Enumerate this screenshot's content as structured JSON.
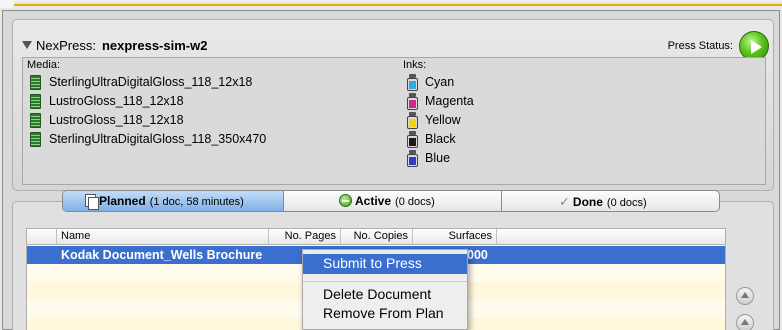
{
  "press": {
    "prefix": "NexPress:",
    "name": "nexpress-sim-w2",
    "status_label": "Press Status:"
  },
  "media": {
    "label": "Media:",
    "items": [
      "SterlingUltraDigitalGloss_118_12x18",
      "LustroGloss_118_12x18",
      "LustroGloss_118_12x18",
      "SterlingUltraDigitalGloss_118_350x470"
    ]
  },
  "inks": {
    "label": "Inks:",
    "items": [
      {
        "name": "Cyan",
        "color": "#2fa8e0"
      },
      {
        "name": "Magenta",
        "color": "#d0288a"
      },
      {
        "name": "Yellow",
        "color": "#f2d20a"
      },
      {
        "name": "Black",
        "color": "#1a1a1a"
      },
      {
        "name": "Blue",
        "color": "#2a3fc8"
      }
    ]
  },
  "tabs": [
    {
      "label": "Planned",
      "count": "(1 doc, 58 minutes)"
    },
    {
      "label": "Active",
      "count": "(0 docs)"
    },
    {
      "label": "Done",
      "count": "(0 docs)"
    }
  ],
  "table": {
    "columns": [
      "Name",
      "No. Pages",
      "No. Copies",
      "Surfaces"
    ],
    "rows": [
      {
        "name": "Kodak Document_Wells Brochure",
        "surfaces_visible": "000"
      }
    ]
  },
  "context_menu": {
    "items": [
      "Submit to Press",
      "Delete Document",
      "Remove From Plan"
    ]
  }
}
